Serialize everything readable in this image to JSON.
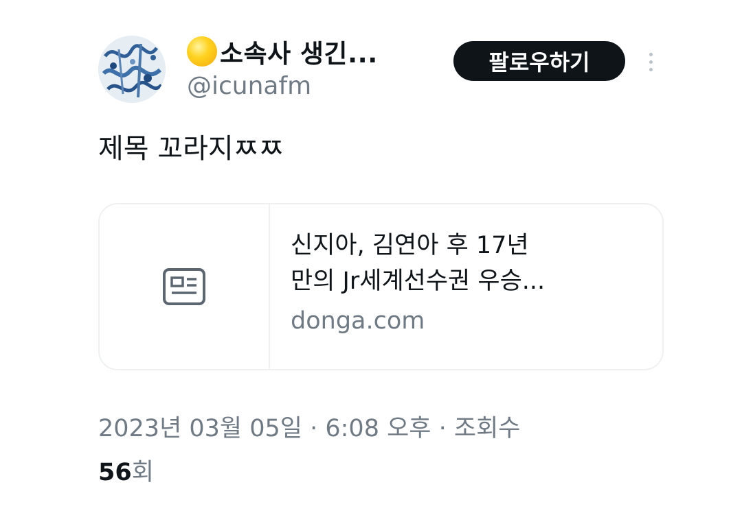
{
  "author": {
    "display_name": "소속사 생긴...",
    "handle": "@icunafm",
    "emoji_icon": "sun-emoji-icon"
  },
  "follow_button": {
    "label": "팔로우하기"
  },
  "more_icon": "more-vertical-icon",
  "tweet": {
    "text": "제목 꼬라지ㅉㅉ"
  },
  "link_card": {
    "thumb_icon": "article-icon",
    "title_line1": "신지아, 김연아 후 17년",
    "title_line2": "만의 Jr세계선수권 우승...",
    "domain": "donga.com"
  },
  "meta": {
    "timestamp": "2023년 03월 05일 · 6:08 오후 · 조회수",
    "views_count": "56",
    "views_unit": "회"
  },
  "colors": {
    "text": "#0f1419",
    "secondary": "#6f7a85",
    "button_bg": "#0f1419",
    "border": "#eef0f2"
  }
}
